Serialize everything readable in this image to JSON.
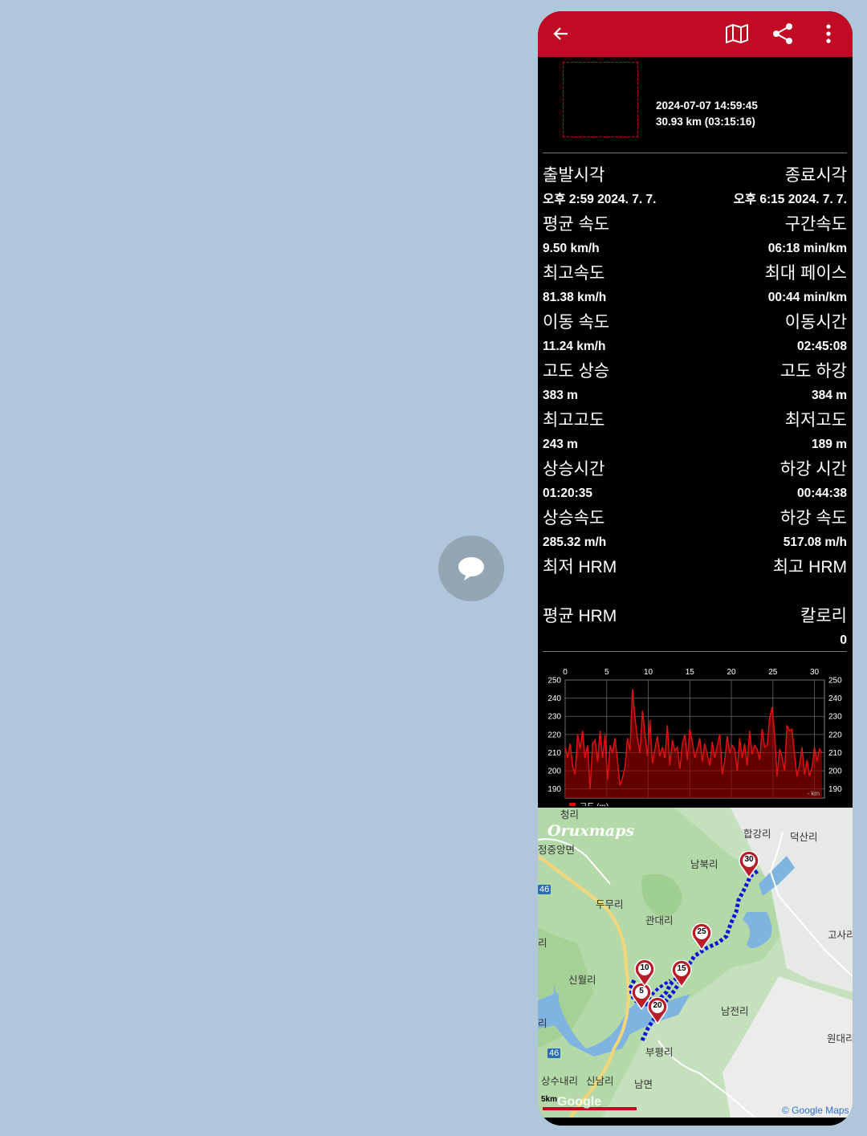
{
  "appbar": {
    "color": "#c10b25",
    "icons": [
      "back-arrow-icon",
      "map-icon",
      "share-icon",
      "more-vert-icon"
    ]
  },
  "summary": {
    "datetime": "2024-07-07 14:59:45",
    "distance_time": "30.93 km (03:15:16)"
  },
  "stats": [
    {
      "left_label": "출발시각",
      "left_value": "오후 2:59 2024. 7. 7.",
      "right_label": "종료시각",
      "right_value": "오후 6:15 2024. 7. 7."
    },
    {
      "left_label": "평균 속도",
      "left_value": "9.50 km/h",
      "right_label": "구간속도",
      "right_value": "06:18 min/km"
    },
    {
      "left_label": "최고속도",
      "left_value": "81.38 km/h",
      "right_label": "최대 페이스",
      "right_value": "00:44 min/km"
    },
    {
      "left_label": "이동 속도",
      "left_value": "11.24 km/h",
      "right_label": "이동시간",
      "right_value": "02:45:08"
    },
    {
      "left_label": "고도 상승",
      "left_value": "383 m",
      "right_label": "고도 하강",
      "right_value": "384 m"
    },
    {
      "left_label": "최고고도",
      "left_value": "243 m",
      "right_label": "최저고도",
      "right_value": "189 m"
    },
    {
      "left_label": "상승시간",
      "left_value": "01:20:35",
      "right_label": "하강 시간",
      "right_value": "00:44:38"
    },
    {
      "left_label": "상승속도",
      "left_value": "285.32 m/h",
      "right_label": "하강 속도",
      "right_value": "517.08 m/h"
    },
    {
      "left_label": "최저 HRM",
      "left_value": "",
      "right_label": "최고 HRM",
      "right_value": ""
    },
    {
      "left_label": "평균 HRM",
      "left_value": "",
      "right_label": "칼로리",
      "right_value": "0"
    }
  ],
  "chart_data": {
    "type": "area",
    "x_ticks": [
      0,
      5,
      10,
      15,
      20,
      25,
      30
    ],
    "y_ticks": [
      190,
      200,
      210,
      220,
      230,
      240,
      250
    ],
    "xlim": [
      0,
      31.2
    ],
    "ylim": [
      185,
      250
    ],
    "xunit": "km",
    "legend": "고도 (m)",
    "legend_placement": "bottom-left",
    "color": "#e01010",
    "grid": true,
    "x": [
      0,
      0.3,
      0.6,
      0.9,
      1.2,
      1.5,
      1.8,
      2.1,
      2.4,
      2.7,
      3.0,
      3.3,
      3.6,
      3.9,
      4.2,
      4.5,
      4.8,
      5.1,
      5.4,
      5.7,
      6.0,
      6.3,
      6.6,
      6.9,
      7.2,
      7.5,
      7.8,
      8.1,
      8.4,
      8.7,
      9.0,
      9.3,
      9.6,
      9.9,
      10.2,
      10.5,
      10.8,
      11.1,
      11.4,
      11.7,
      12.0,
      12.3,
      12.6,
      12.9,
      13.2,
      13.5,
      13.8,
      14.1,
      14.4,
      14.7,
      15.0,
      15.3,
      15.6,
      15.9,
      16.2,
      16.5,
      16.8,
      17.1,
      17.4,
      17.7,
      18.0,
      18.3,
      18.6,
      18.9,
      19.2,
      19.5,
      19.8,
      20.1,
      20.4,
      20.7,
      21.0,
      21.3,
      21.6,
      21.9,
      22.2,
      22.5,
      22.8,
      23.1,
      23.4,
      23.7,
      24.0,
      24.3,
      24.6,
      24.9,
      25.2,
      25.5,
      25.8,
      26.1,
      26.4,
      26.7,
      27.0,
      27.3,
      27.6,
      27.9,
      28.2,
      28.5,
      28.8,
      29.1,
      29.4,
      29.7,
      30.0,
      30.3,
      30.6,
      30.9
    ],
    "y": [
      213,
      207,
      215,
      203,
      198,
      220,
      212,
      222,
      207,
      214,
      190,
      215,
      217,
      205,
      222,
      207,
      220,
      195,
      214,
      210,
      218,
      206,
      192,
      196,
      202,
      218,
      211,
      245,
      229,
      218,
      210,
      233,
      220,
      208,
      228,
      204,
      212,
      219,
      208,
      213,
      207,
      225,
      203,
      217,
      211,
      213,
      201,
      215,
      220,
      206,
      223,
      216,
      207,
      212,
      218,
      205,
      215,
      209,
      203,
      216,
      207,
      214,
      220,
      198,
      206,
      219,
      210,
      214,
      212,
      200,
      218,
      207,
      215,
      203,
      222,
      209,
      214,
      212,
      206,
      223,
      213,
      214,
      229,
      235,
      220,
      197,
      212,
      208,
      200,
      225,
      222,
      223,
      209,
      197,
      203,
      213,
      198,
      206,
      197,
      202,
      213,
      205,
      212,
      210
    ]
  },
  "map": {
    "brand": "Oruxmaps",
    "attribution": "© Google Maps",
    "scale_label": "5km",
    "google": "Google",
    "labels": [
      "청리",
      "정중앙면",
      "합강리",
      "덕산리",
      "남북리",
      "두무리",
      "관대리",
      "고사리",
      "신월리",
      "남전리",
      "원대리",
      "부평리",
      "상수내리",
      "신남리",
      "남면",
      "46",
      "46",
      "리",
      "리"
    ],
    "markers": [
      "5",
      "10",
      "15",
      "20",
      "25",
      "30"
    ],
    "track_color": "#0a14d8"
  }
}
